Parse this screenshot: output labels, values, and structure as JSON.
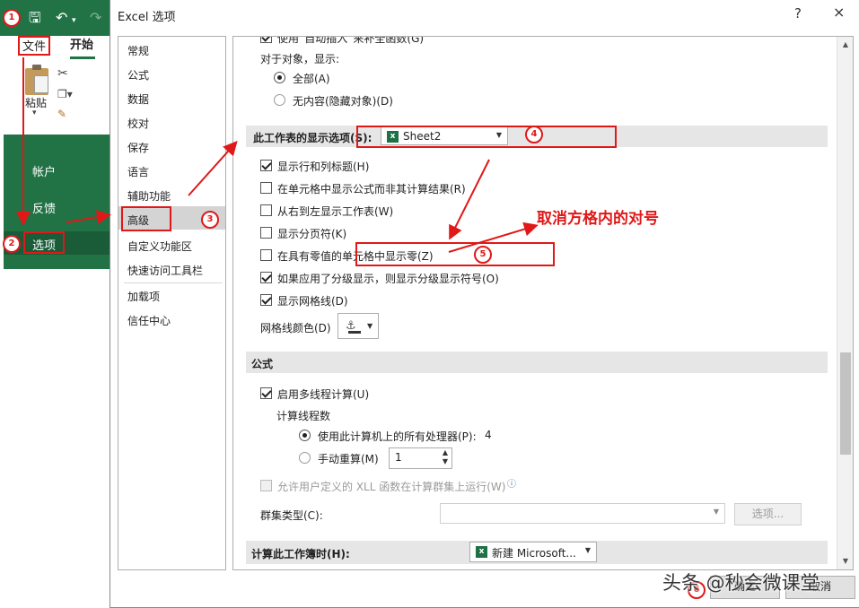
{
  "app": {
    "ribbon_tabs": {
      "file": "文件",
      "home": "开始"
    },
    "paste_label": "粘贴",
    "backstage_items": [
      "帐户",
      "反馈",
      "选项"
    ]
  },
  "dialog": {
    "title": "Excel 选项",
    "help": "?",
    "close": "×",
    "categories": [
      "常规",
      "公式",
      "数据",
      "校对",
      "保存",
      "语言",
      "辅助功能",
      "高级",
      "自定义功能区",
      "快速访问工具栏",
      "加载项",
      "信任中心"
    ],
    "selected_category": "高级",
    "objects": {
      "truncated_top": "使用“自动插入”来补全函数(G)",
      "label": "对于对象，显示:",
      "options": [
        "全部(A)",
        "无内容(隐藏对象)(D)"
      ],
      "selected": "全部(A)"
    },
    "sheet_section": {
      "title": "此工作表的显示选项(S):",
      "sheet_select": "Sheet2",
      "options": [
        {
          "label": "显示行和列标题(H)",
          "checked": true
        },
        {
          "label": "在单元格中显示公式而非其计算结果(R)",
          "checked": false
        },
        {
          "label": "从右到左显示工作表(W)",
          "checked": false
        },
        {
          "label": "显示分页符(K)",
          "checked": false
        },
        {
          "label": "在具有零值的单元格中显示零(Z)",
          "checked": false
        },
        {
          "label": "如果应用了分级显示，则显示分级显示符号(O)",
          "checked": true
        },
        {
          "label": "显示网格线(D)",
          "checked": true
        }
      ],
      "gridline_color_label": "网格线颜色(D)"
    },
    "formula_section": {
      "title": "公式",
      "multithread_label": "启用多线程计算(U)",
      "multithread_checked": true,
      "threads_label": "计算线程数",
      "use_all_label": "使用此计算机上的所有处理器(P):",
      "use_all_value": "4",
      "manual_label": "手动重算(M)",
      "manual_value": "1",
      "xll_label": "允许用户定义的 XLL 函数在计算群集上运行(W)",
      "cluster_type_label": "群集类型(C):",
      "options_button": "选项..."
    },
    "workbook_section": {
      "title": "计算此工作簿时(H):",
      "workbook_select": "新建 Microsoft..."
    },
    "ok_button": "确定",
    "cancel_button": "取消"
  },
  "annotations": {
    "badges": [
      "1",
      "2",
      "3",
      "4",
      "5",
      "6"
    ],
    "instruction": "取消方格内的对号",
    "watermark": "头条 @秒会微课堂"
  },
  "colors": {
    "excel_green": "#217346",
    "annotation_red": "#e01818"
  }
}
